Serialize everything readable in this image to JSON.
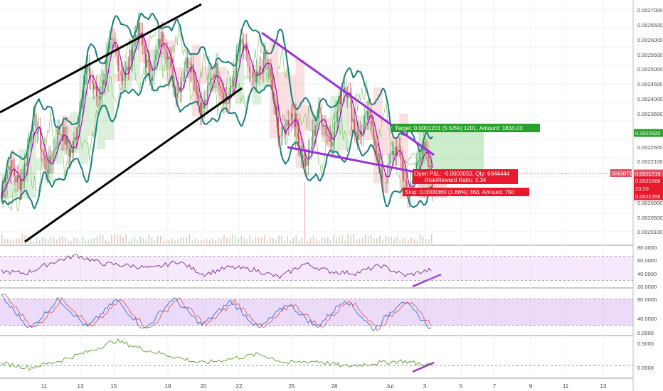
{
  "symbol": "BNBBTC",
  "colors": {
    "price_tag": "#e84f61",
    "target_box": "#2aa12a",
    "stop_box": "#e8192c",
    "trendline": "#000000",
    "wedge": "#9b30d9",
    "bollinger": "#1b7f7f",
    "ema": "#b000c8",
    "rsi_line": "#7e2a8e",
    "stoch_k": "#3b6fd1",
    "stoch_d": "#e05050",
    "osc_line": "#5aa02c",
    "divergence": "#9b30d9"
  },
  "price_axis": {
    "ticks": [
      "0.0027000",
      "0.0026500",
      "0.0026000",
      "0.0025500",
      "0.0025000",
      "0.0024500",
      "0.0024000",
      "0.0023500",
      "0.0022500",
      "0.0022100",
      "0.0020900",
      "0.0020500",
      "0.0020100"
    ],
    "tags": [
      {
        "label": "0.0022920",
        "color": "#2aa12a"
      },
      {
        "label": "0.0021719",
        "color": "#e84f61"
      },
      {
        "label": "0.0021666",
        "color": "#e8192c"
      },
      {
        "label": "23:20",
        "color": "#e8192c"
      },
      {
        "label": "0.0021359",
        "color": "#e8192c"
      }
    ]
  },
  "rsi_axis": [
    "80.0000",
    "60.0000",
    "40.0000",
    "20.0000"
  ],
  "stoch_axis": [
    "80.0000",
    "40.0000",
    "0.0000"
  ],
  "osc_axis": [
    "0.5000",
    "0.0000"
  ],
  "dates": [
    "11",
    "13",
    "15",
    "18",
    "20",
    "22",
    "25",
    "28",
    "Jul",
    "3",
    "5",
    "7",
    "9",
    "11",
    "13"
  ],
  "trade": {
    "target": "Target: 0.0001201 (5.53%) 1201, Amount: 1834.03",
    "open_pl": "Open P&L: -0.0000053, Qty: 6944444",
    "risk_reward": "Risk/Reward Ratio: 3.34",
    "stop": "Stop: 0.0000360 (1.66%) 360, Amount: 750"
  },
  "chart_data": [
    {
      "type": "line",
      "title": "",
      "series": [
        {
          "name": "BNBBTC",
          "x": [
            "11",
            "13",
            "15",
            "18",
            "20",
            "22",
            "25",
            "28",
            "Jul",
            "3"
          ],
          "values": [
            0.00213,
            0.0023,
            0.00245,
            0.00262,
            0.00243,
            0.00255,
            0.00233,
            0.00237,
            0.00228,
            0.002172
          ]
        }
      ],
      "ylim": [
        0.00199,
        0.00272
      ],
      "last_price": 0.0021719,
      "target_price": 0.002292,
      "stop_price": 0.0021359
    },
    {
      "type": "line",
      "series": [
        {
          "values": [
            45,
            42,
            60,
            72,
            58,
            55,
            50,
            62,
            40,
            52,
            48,
            35,
            58,
            45,
            42,
            55,
            38,
            48
          ]
        }
      ],
      "ylim": [
        20,
        85
      ],
      "band": [
        30,
        70
      ]
    },
    {
      "type": "line",
      "series": [
        {
          "values": [
            85,
            12,
            80,
            15,
            78,
            10,
            82,
            20,
            75,
            12,
            70,
            15,
            80,
            10,
            78,
            12
          ]
        }
      ],
      "ylim": [
        0,
        100
      ],
      "band": [
        20,
        80
      ]
    },
    {
      "type": "line",
      "series": [
        {
          "values": [
            0.05,
            -0.05,
            0.1,
            0.3,
            0.55,
            0.35,
            0.2,
            0.05,
            0.15,
            0.25,
            0.05,
            0.1,
            -0.02,
            0.05,
            0.1,
            0.0
          ]
        }
      ],
      "ylim": [
        -0.25,
        0.6
      ]
    }
  ]
}
